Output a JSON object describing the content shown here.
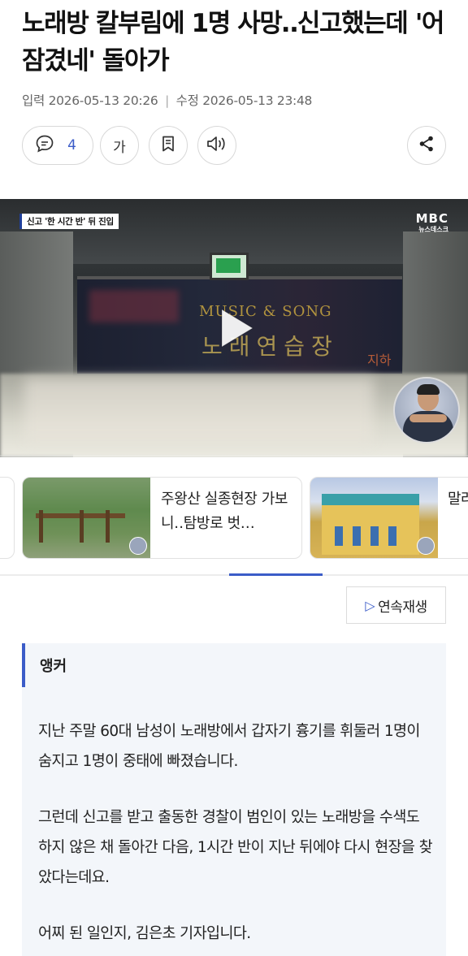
{
  "article": {
    "title": "노래방 칼부림에 1명 사망‥신고했는데 '어 잠겼네' 돌아가",
    "meta": {
      "published_label": "입력",
      "published": "2026-05-13 20:26",
      "separator": "|",
      "modified_label": "수정",
      "modified": "2026-05-13 23:48"
    }
  },
  "actions": {
    "comment_count": "4",
    "font_label": "가",
    "icons": [
      "comment-icon",
      "bookmark-icon",
      "speaker-icon",
      "share-icon"
    ]
  },
  "video": {
    "caption": "신고 '한 시간 반' 뒤 진입",
    "logo_top": "MBC",
    "logo_bottom": "뉴스데스크",
    "scene_sign_en": "MUSIC & SONG",
    "scene_sign_ko": "노래연습장",
    "scene_sign_sub": "지하",
    "play_icon": "play-icon"
  },
  "related": [
    {
      "title": "주왕산 실종현장 가보니‥탐방로 벗…"
    },
    {
      "title": "말려 데"
    },
    {
      "title": "-"
    }
  ],
  "autoplay_label": "연속재생",
  "body": {
    "anchor_label": "앵커",
    "paragraphs": [
      "지난 주말 60대 남성이 노래방에서 갑자기 흉기를 휘둘러 1명이 숨지고 1명이 중태에 빠졌습니다.",
      "그런데 신고를 받고 출동한 경찰이 범인이 있는 노래방을 수색도 하지 않은 채 돌아간 다음, 1시간 반이 지난 뒤에야 다시 현장을 찾았다는데요.",
      "어찌 된 일인지, 김은초 기자입니다."
    ]
  },
  "colors": {
    "accent": "#3b5cc8",
    "text": "#111111",
    "meta": "#666666",
    "quote_bg": "#f3f6fa"
  }
}
